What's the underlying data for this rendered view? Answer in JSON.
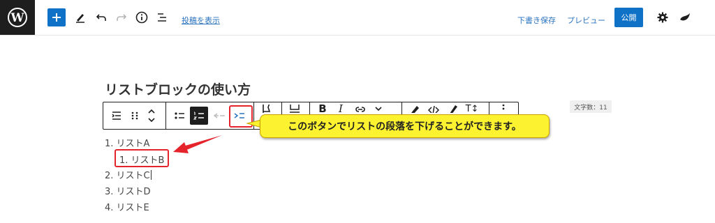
{
  "topbar": {
    "view_post_link": "投稿を表示",
    "save_draft": "下書き保存",
    "preview": "プレビュー",
    "publish": "公開"
  },
  "editor": {
    "title": "リストブロックの使い方",
    "word_count": "文字数：11",
    "list": [
      {
        "number": "1.",
        "text": "リストA"
      },
      {
        "number": "1.",
        "text": "リストB"
      },
      {
        "number": "2.",
        "text": "リストC"
      },
      {
        "number": "3.",
        "text": "リストD"
      },
      {
        "number": "4.",
        "text": "リストE"
      }
    ]
  },
  "annotation": {
    "callout_text": "このボタンでリストの段落を下げることができます。",
    "accent_color": "#e5232b",
    "callout_color": "#fcf22f"
  },
  "colors": {
    "brand_blue": "#1072c6",
    "dark": "#1e1e1e"
  }
}
